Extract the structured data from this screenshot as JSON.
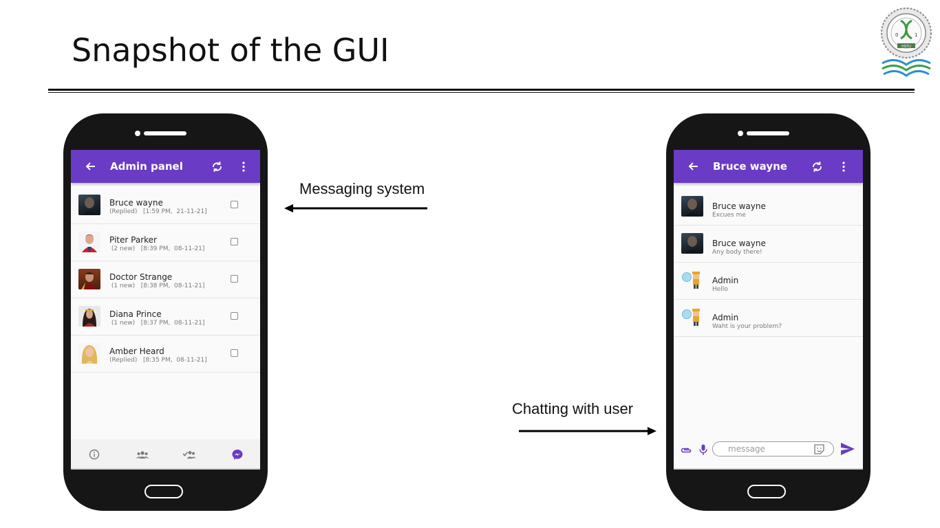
{
  "slide": {
    "title": "Snapshot of the GUI"
  },
  "logo": {
    "icon": "university-seal-icon",
    "text": "HSTU",
    "ring_text": "Hajee Mohammad Danesh Science and Technology University"
  },
  "captions": {
    "messaging": "Messaging system",
    "chatting": "Chatting with user"
  },
  "admin_phone": {
    "appbar": {
      "title": "Admin panel",
      "back_icon": "arrow-back-icon",
      "refresh_icon": "sync-icon",
      "menu_icon": "more-vertical-icon",
      "color": "#6a3bc4"
    },
    "conversations": [
      {
        "name": "Bruce wayne",
        "status": "(Replied)",
        "time": "[1:59 PM,  21-11-21]",
        "checked": false
      },
      {
        "name": "Piter Parker",
        "status": "(2 new)",
        "time": "[8:39 PM,  08-11-21]",
        "checked": false
      },
      {
        "name": "Doctor Strange",
        "status": "(1 new)",
        "time": "[8:38 PM,  08-11-21]",
        "checked": false
      },
      {
        "name": "Diana Prince",
        "status": "(1 new)",
        "time": "[8:37 PM,  08-11-21]",
        "checked": false
      },
      {
        "name": "Amber Heard",
        "status": "(Replied)",
        "time": "[8:35 PM,  08-11-21]",
        "checked": false
      }
    ],
    "bottom_nav": [
      {
        "icon": "info-icon",
        "active": false
      },
      {
        "icon": "group-icon",
        "active": false
      },
      {
        "icon": "group-check-icon",
        "active": false
      },
      {
        "icon": "messenger-icon",
        "active": true
      }
    ]
  },
  "chat_phone": {
    "appbar": {
      "title": "Bruce wayne",
      "back_icon": "arrow-back-icon",
      "refresh_icon": "sync-icon",
      "menu_icon": "more-vertical-icon"
    },
    "messages": [
      {
        "sender": "Bruce wayne",
        "text": "Excues me"
      },
      {
        "sender": "Bruce wayne",
        "text": "Any body there!"
      },
      {
        "sender": "Admin",
        "text": "Hello"
      },
      {
        "sender": "Admin",
        "text": "Waht is your problem?"
      }
    ],
    "composer": {
      "placeholder": "message",
      "attach_icon": "paperclip-icon",
      "mic_icon": "microphone-icon",
      "sticker_icon": "sticker-icon",
      "send_icon": "send-icon",
      "accent": "#6a3bc4"
    }
  }
}
